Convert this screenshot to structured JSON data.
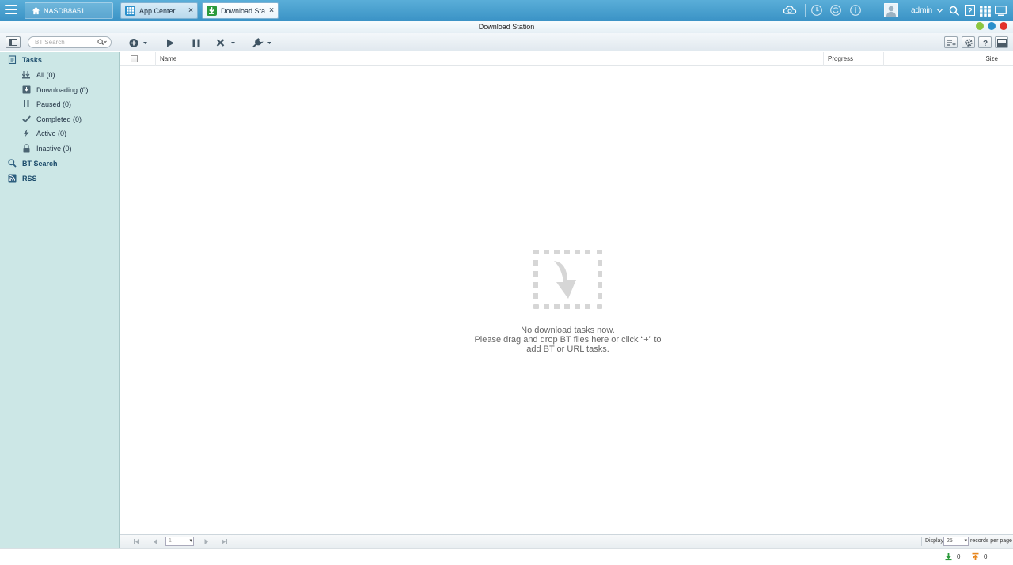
{
  "topbar": {
    "nas_name": "NASDB8A51",
    "tabs": [
      {
        "label": "App Center"
      },
      {
        "label": "Download Sta..."
      }
    ],
    "user": "admin"
  },
  "window": {
    "title": "Download Station"
  },
  "toolbar": {
    "search_placeholder": "BT Search"
  },
  "sidebar": {
    "tasks_label": "Tasks",
    "items": [
      {
        "label": "All (0)"
      },
      {
        "label": "Downloading (0)"
      },
      {
        "label": "Paused (0)"
      },
      {
        "label": "Completed (0)"
      },
      {
        "label": "Active (0)"
      },
      {
        "label": "Inactive (0)"
      }
    ],
    "bt_search_label": "BT Search",
    "rss_label": "RSS"
  },
  "grid": {
    "columns": [
      "Name",
      "Progress",
      "Size"
    ]
  },
  "empty_state": {
    "line1": "No download tasks now.",
    "line2": "Please drag and drop BT files here or click “+” to",
    "line3": "add BT or URL tasks."
  },
  "pager": {
    "page": "1",
    "display_label": "Display",
    "per_page": "25",
    "records_label": "records per page"
  },
  "statusbar": {
    "download_count": "0",
    "upload_count": "0"
  },
  "colors": {
    "topbar": "#3b93c6",
    "sidebar": "#cce7e6",
    "accent_green": "#2c9a3c"
  }
}
